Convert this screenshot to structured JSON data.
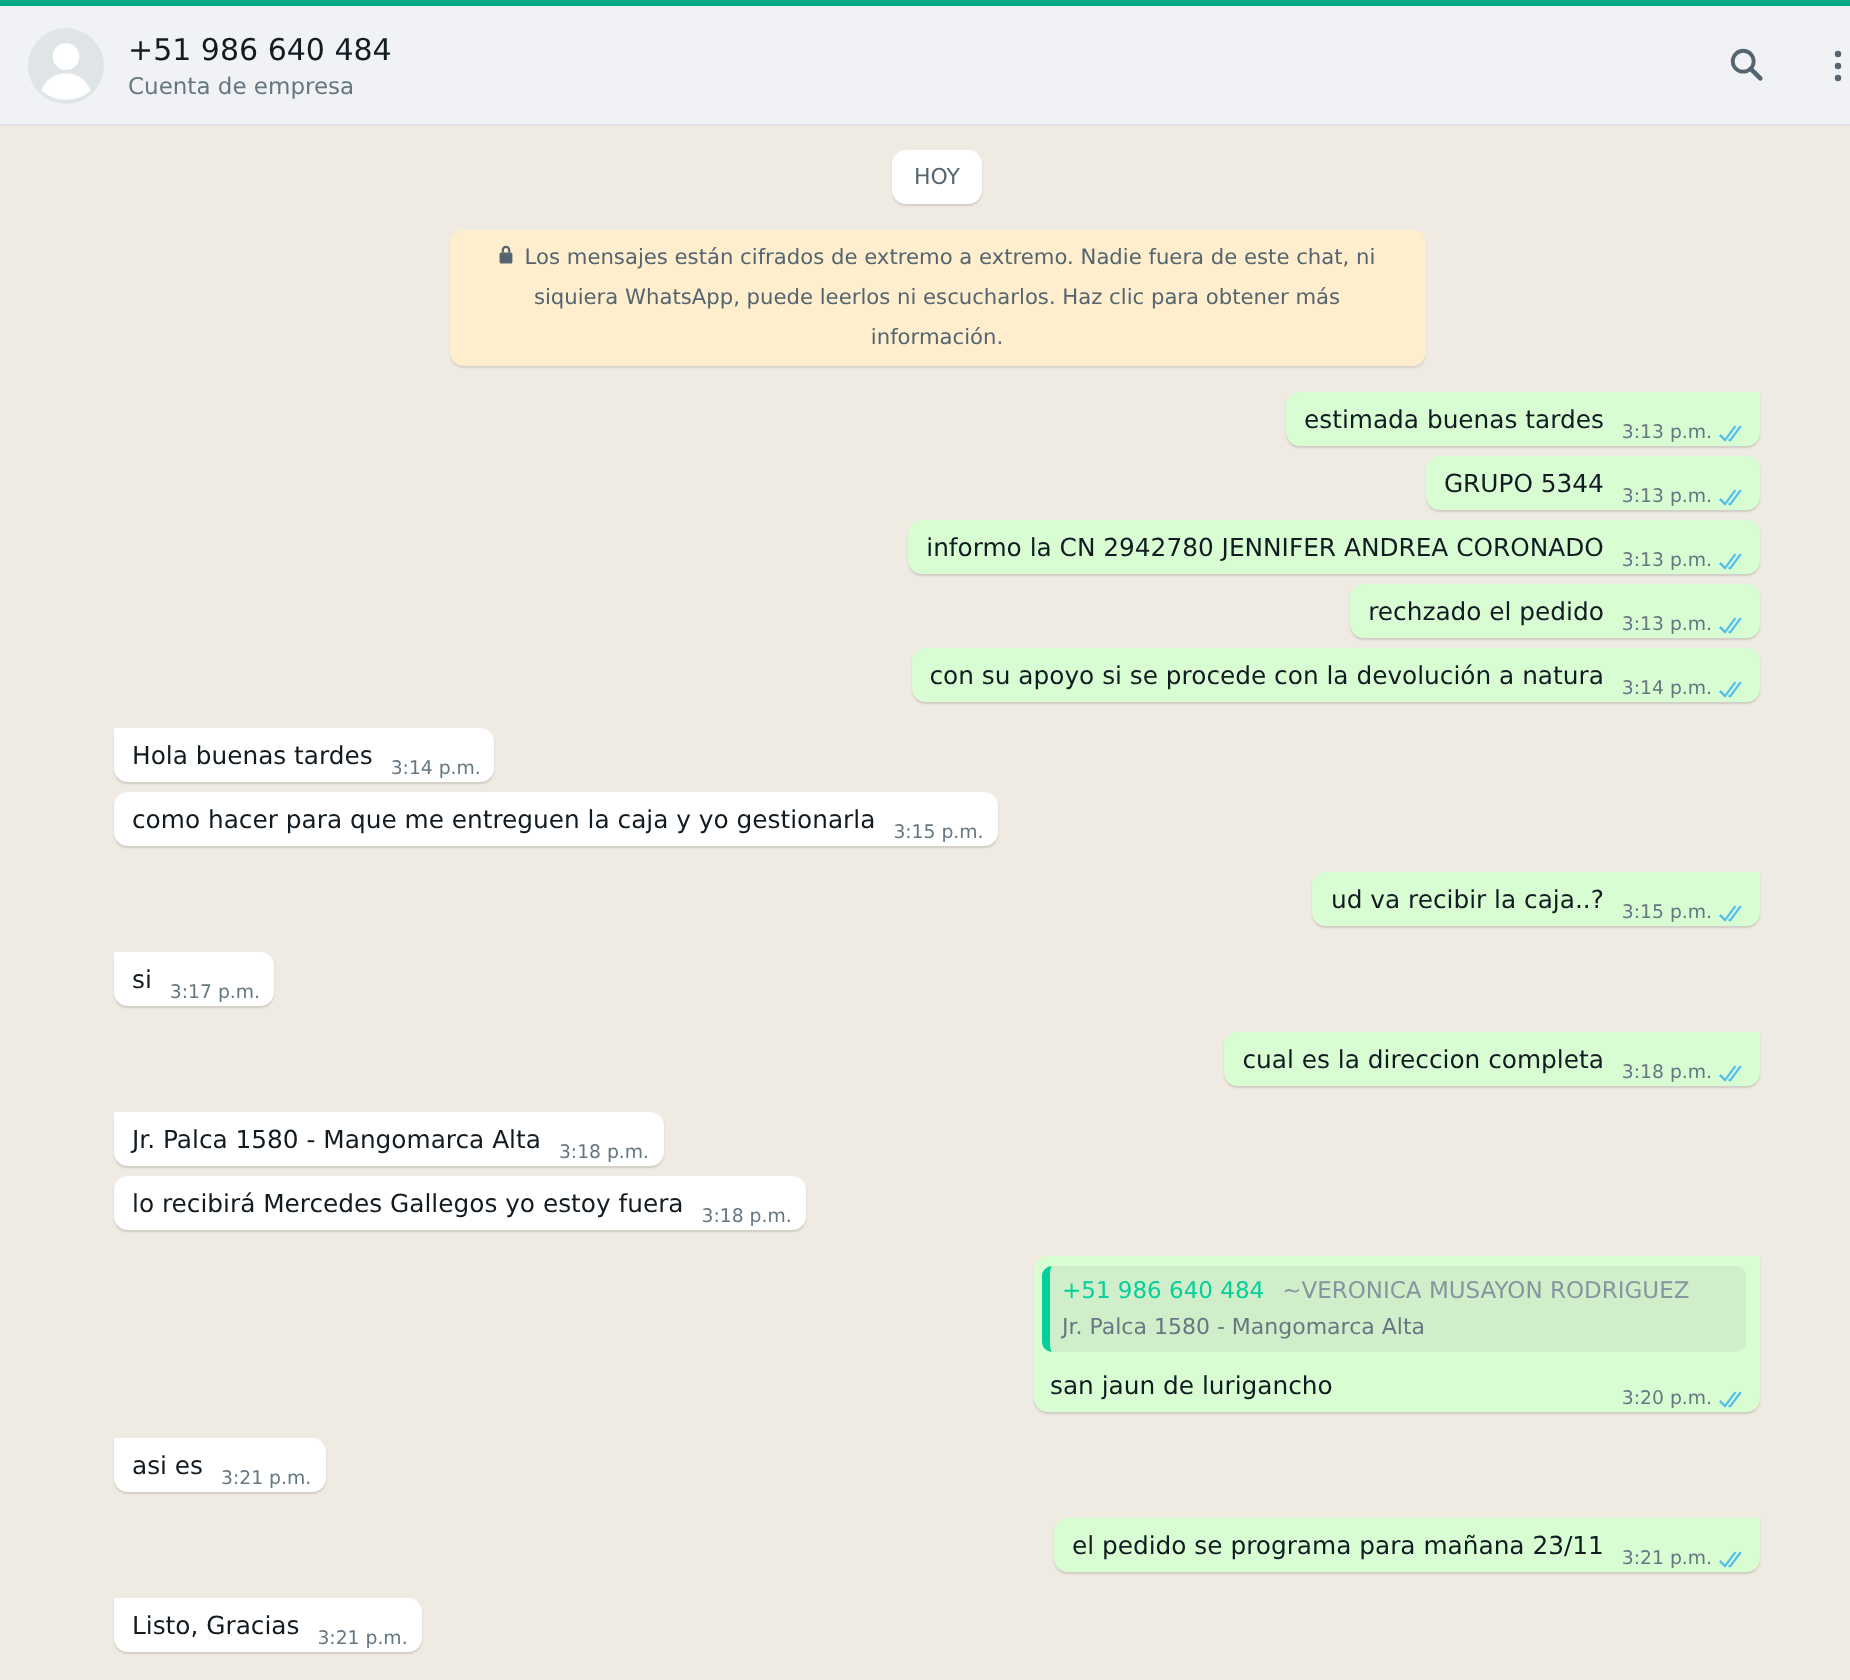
{
  "header": {
    "title": "+51 986 640 484",
    "subtitle": "Cuenta de empresa"
  },
  "date_chip": "HOY",
  "encryption_notice": "Los mensajes están cifrados de extremo a extremo. Nadie fuera de este chat, ni siquiera WhatsApp, puede leerlos ni escucharlos. Haz clic para obtener más información.",
  "messages": [
    {
      "kind": "outgoing",
      "text": "estimada buenas tardes",
      "time": "3:13 p.m.",
      "read": true
    },
    {
      "kind": "outgoing",
      "text": "GRUPO 5344",
      "time": "3:13 p.m.",
      "read": true
    },
    {
      "kind": "outgoing",
      "text": "informo la CN 2942780 JENNIFER ANDREA CORONADO",
      "time": "3:13 p.m.",
      "read": true
    },
    {
      "kind": "outgoing",
      "text": "rechzado el pedido",
      "time": "3:13 p.m.",
      "read": true
    },
    {
      "kind": "outgoing",
      "text": "con su apoyo si se procede con la devolución a natura",
      "time": "3:14 p.m.",
      "read": true
    },
    {
      "kind": "incoming",
      "text": "Hola buenas tardes",
      "time": "3:14 p.m."
    },
    {
      "kind": "incoming",
      "text": "como hacer para que me entreguen la caja y yo gestionarla",
      "time": "3:15 p.m."
    },
    {
      "kind": "outgoing",
      "text": "ud va recibir la caja..?",
      "time": "3:15 p.m.",
      "read": true
    },
    {
      "kind": "incoming",
      "text": "si",
      "time": "3:17 p.m."
    },
    {
      "kind": "outgoing",
      "text": "cual es la direccion completa",
      "time": "3:18 p.m.",
      "read": true
    },
    {
      "kind": "incoming",
      "text": "Jr. Palca 1580 - Mangomarca Alta",
      "time": "3:18 p.m."
    },
    {
      "kind": "incoming",
      "text": "lo recibirá Mercedes Gallegos yo estoy fuera",
      "time": "3:18 p.m."
    },
    {
      "kind": "outgoing",
      "text": "san jaun de lurigancho",
      "time": "3:20 p.m.",
      "read": true,
      "quote": {
        "sender": "+51 986 640 484",
        "name": "~VERONICA MUSAYON RODRIGUEZ",
        "text": "Jr. Palca 1580 - Mangomarca Alta"
      }
    },
    {
      "kind": "incoming",
      "text": "asi es",
      "time": "3:21 p.m."
    },
    {
      "kind": "outgoing",
      "text": "el pedido se programa para mañana 23/11",
      "time": "3:21 p.m.",
      "read": true
    },
    {
      "kind": "incoming",
      "text": "Listo, Gracias",
      "time": "3:21 p.m."
    }
  ]
}
